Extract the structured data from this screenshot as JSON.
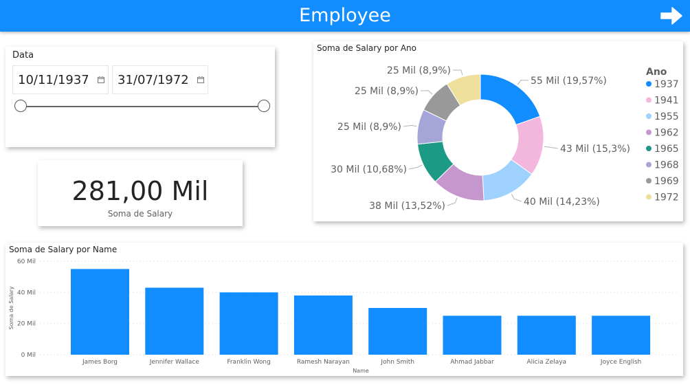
{
  "header": {
    "title": "Employee",
    "arrow_icon": "arrow-right-icon"
  },
  "slicer": {
    "title": "Data",
    "start_date": "10/11/1937",
    "end_date": "31/07/1972",
    "range_fraction": [
      0,
      1
    ]
  },
  "kpi": {
    "value": "281,00 Mil",
    "label": "Soma de Salary"
  },
  "donut": {
    "title": "Soma de Salary por Ano",
    "legend_title": "Ano",
    "chart_data": {
      "type": "pie",
      "title": "Soma de Salary por Ano",
      "legend_title": "Ano",
      "legend_placement": "right",
      "slices": [
        {
          "name": "1937",
          "value": 55,
          "label": "55 Mil (19,57%)",
          "color": "#118dff"
        },
        {
          "name": "1941",
          "value": 43,
          "label": "43 Mil (15,3%)",
          "color": "#f3b6dd"
        },
        {
          "name": "1955",
          "value": 40,
          "label": "40 Mil (14,23%)",
          "color": "#9fd1ff"
        },
        {
          "name": "1962",
          "value": 38,
          "label": "38 Mil (13,52%)",
          "color": "#c597cd"
        },
        {
          "name": "1965",
          "value": 30,
          "label": "30 Mil (10,68%)",
          "color": "#1c9a86"
        },
        {
          "name": "1968",
          "value": 25,
          "label": "25 Mil (8,9%)",
          "color": "#a5a6d7"
        },
        {
          "name": "1969",
          "value": 25,
          "label": "25 Mil (8,9%)",
          "color": "#999999"
        },
        {
          "name": "1972",
          "value": 25,
          "label": "25 Mil (8,9%)",
          "color": "#efdf9c"
        }
      ]
    }
  },
  "bar": {
    "title": "Soma de Salary por Name",
    "chart_data": {
      "type": "bar",
      "title": "Soma de Salary por Name",
      "xlabel": "Name",
      "ylabel": "Soma de Salary",
      "ylim": [
        0,
        60
      ],
      "yticks": [
        0,
        20,
        40,
        60
      ],
      "ytick_labels": [
        "0 Mil",
        "20 Mil",
        "40 Mil",
        "60 Mil"
      ],
      "grid": true,
      "color": "#118dff",
      "categories": [
        "James Borg",
        "Jennifer Wallace",
        "Franklin Wong",
        "Ramesh Narayan",
        "John Smith",
        "Ahmad Jabbar",
        "Alicia Zelaya",
        "Joyce English"
      ],
      "values": [
        55,
        43,
        40,
        38,
        30,
        25,
        25,
        25
      ]
    }
  }
}
